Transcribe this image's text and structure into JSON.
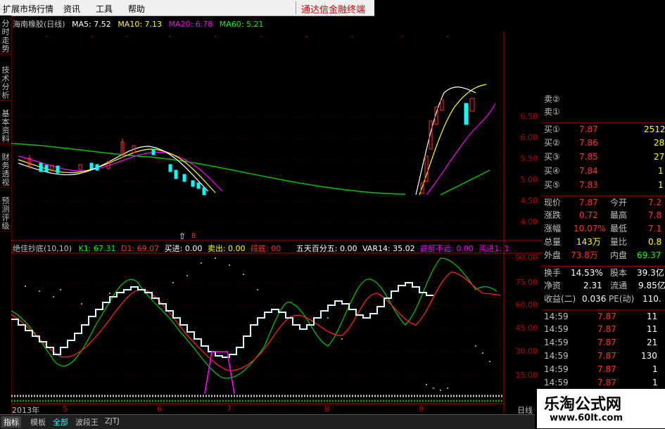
{
  "menu": {
    "items": [
      "扩展市场行情",
      "资讯",
      "工具",
      "帮助"
    ],
    "brand": "通达信金融终端"
  },
  "left_tabs": [
    "分时走势",
    "技术分析",
    "基本资料",
    "财务透视",
    "预测评级"
  ],
  "chart_header": {
    "title": "海南橡胶(日线)",
    "ma5": "MA5: 7.52",
    "ma10": "MA10: 7.13",
    "ma20": "MA20: 6.78",
    "ma60": "MA60: 5.21"
  },
  "price_axis": [
    "6.50",
    "6.00",
    "5.50",
    "5.00",
    "4.50",
    "4.00"
  ],
  "indicator_header": {
    "name": "绝佳抄底(10,10)",
    "k": "K1: 67.31",
    "d": "D1: 69.07",
    "buy": "买进: 0.00",
    "sell": "卖出: 0.00",
    "x": "段底: 00",
    "five": "五天百分五: 0.00",
    "var14": "VAR14: 35.02",
    "bottom": "底部不远: 0.00",
    "buy1": "买进1: 1"
  },
  "indicator_axis": [
    "90.00",
    "75.00",
    "60.00",
    "45.00",
    "30.00",
    "15.00"
  ],
  "time_axis": {
    "year": "2013年",
    "months": [
      "5",
      "6",
      "7",
      "8",
      "9"
    ],
    "right": "日线"
  },
  "quote": {
    "orderbook_top": [
      "卖②",
      "卖①"
    ],
    "bids": [
      {
        "label": "买①",
        "price": "7.87",
        "vol": "2512"
      },
      {
        "label": "买②",
        "price": "7.86",
        "vol": "28"
      },
      {
        "label": "买③",
        "price": "7.85",
        "vol": "27"
      },
      {
        "label": "买④",
        "price": "7.84",
        "vol": "1"
      },
      {
        "label": "买⑤",
        "price": "7.83",
        "vol": "1"
      }
    ],
    "stats": [
      {
        "k1": "现价",
        "v1": "7.87",
        "k2": "今开",
        "v2": "7.2"
      },
      {
        "k1": "涨跌",
        "v1": "0.72",
        "k2": "最高",
        "v2": "7.8"
      },
      {
        "k1": "涨幅",
        "v1": "10.07%",
        "k2": "最低",
        "v2": "7.1"
      },
      {
        "k1": "总量",
        "v1": "143万",
        "k2": "量比",
        "v2": "0.8"
      },
      {
        "k1": "外盘",
        "v1": "73.8万",
        "k2": "内盘",
        "v2": "69.37"
      }
    ],
    "fin": [
      {
        "k1": "换手",
        "v1": "14.53%",
        "k2": "股本",
        "v2": "39.3亿"
      },
      {
        "k1": "净资",
        "v1": "2.31",
        "k2": "流通",
        "v2": "9.85亿"
      },
      {
        "k1": "收益(二)",
        "v1": "0.036",
        "k2": "PE(动)",
        "v2": "110."
      }
    ],
    "ticks": [
      {
        "t": "14:59",
        "p": "7.87",
        "v": "11"
      },
      {
        "t": "14:59",
        "p": "7.87",
        "v": "11"
      },
      {
        "t": "14:59",
        "p": "7.87",
        "v": "21"
      },
      {
        "t": "14:59",
        "p": "7.87",
        "v": "130"
      },
      {
        "t": "14:59",
        "p": "7.87",
        "v": "1"
      },
      {
        "t": "14:59",
        "p": "7.87",
        "v": "1"
      }
    ]
  },
  "bottom_tabs": [
    "指标",
    "模板",
    "全部",
    "波段王",
    "ZJTJ"
  ],
  "watermark": {
    "title": "乐淘公式网",
    "url": "www.60lt.com"
  },
  "colors": {
    "up": "#ff3030",
    "down": "#00ffff",
    "accent_red": "#d00000",
    "white": "#ffffff",
    "yellow": "#ffff00"
  }
}
